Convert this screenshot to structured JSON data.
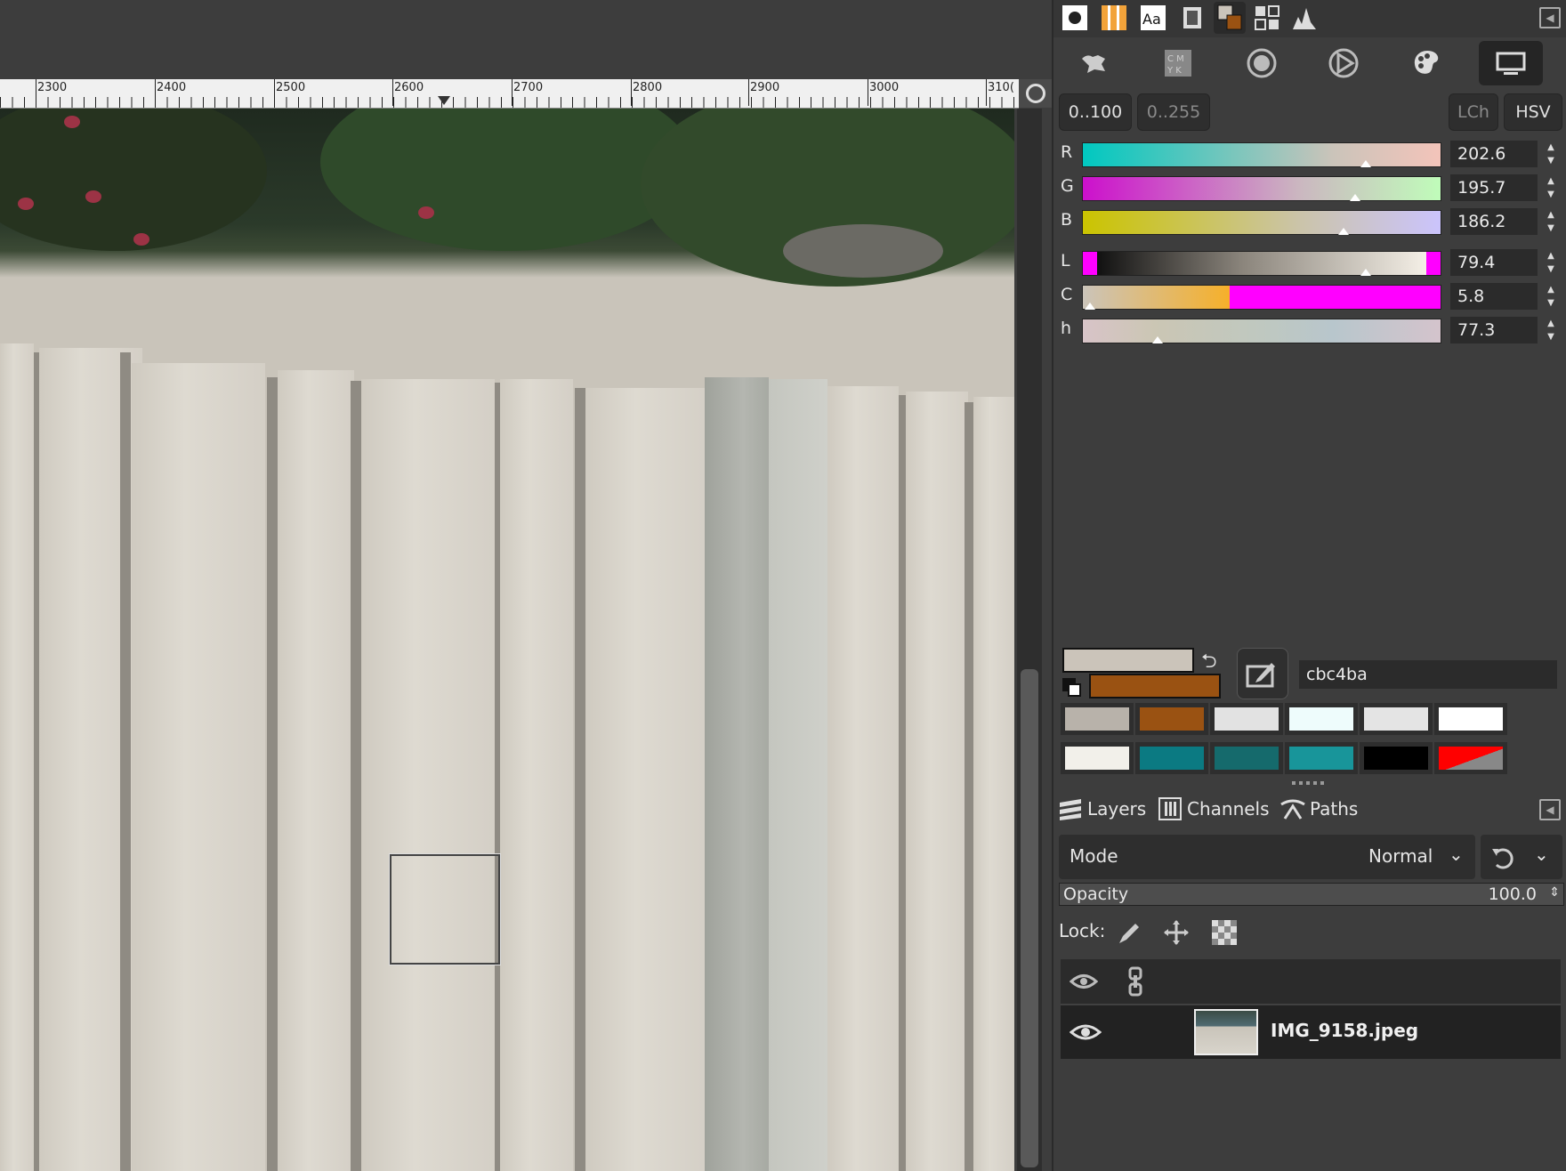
{
  "ruler": {
    "labels": [
      "2300",
      "2400",
      "2500",
      "2600",
      "2700",
      "2800",
      "2900",
      "3000",
      "310("
    ]
  },
  "dock_tabs": [
    "brushes-icon",
    "gradients-icon",
    "fonts-icon",
    "images-icon",
    "colors-icon",
    "patterns-icon",
    "histogram-icon"
  ],
  "color_selectors": [
    "gimp-selector-icon",
    "cmyk-selector-icon",
    "watercolor-selector-icon",
    "triangle-selector-icon",
    "palette-selector-icon",
    "scales-selector-icon"
  ],
  "range": {
    "pct": "0..100",
    "byte": "0..255",
    "lch": "LCh",
    "hsv": "HSV"
  },
  "channels": [
    {
      "label": "R",
      "value": "202.6",
      "marker": 0.79
    },
    {
      "label": "G",
      "value": "195.7",
      "marker": 0.76
    },
    {
      "label": "B",
      "value": "186.2",
      "marker": 0.73
    },
    {
      "label": "L",
      "value": "79.4",
      "marker": 0.79
    },
    {
      "label": "C",
      "value": "5.8",
      "marker": 0.02
    },
    {
      "label": "h",
      "value": "77.3",
      "marker": 0.21
    }
  ],
  "colors": {
    "foreground": "#cbc4ba",
    "background": "#9a5212",
    "hex": "cbc4ba"
  },
  "history": [
    "#b8b2aa",
    "#9a5212",
    "#e2e2e2",
    "#eefcfc",
    "#e4e4e4",
    "#ffffff",
    "#f2f0ea",
    "#0b7a82",
    "#156a6c",
    "#18959a",
    "#000000",
    "gradient-red"
  ],
  "layers_panel": {
    "tabs": {
      "layers": "Layers",
      "channels": "Channels",
      "paths": "Paths"
    },
    "mode_label": "Mode",
    "mode_value": "Normal",
    "opacity_label": "Opacity",
    "opacity_value": "100.0",
    "lock_label": "Lock:",
    "layer_name": "IMG_9158.jpeg"
  }
}
